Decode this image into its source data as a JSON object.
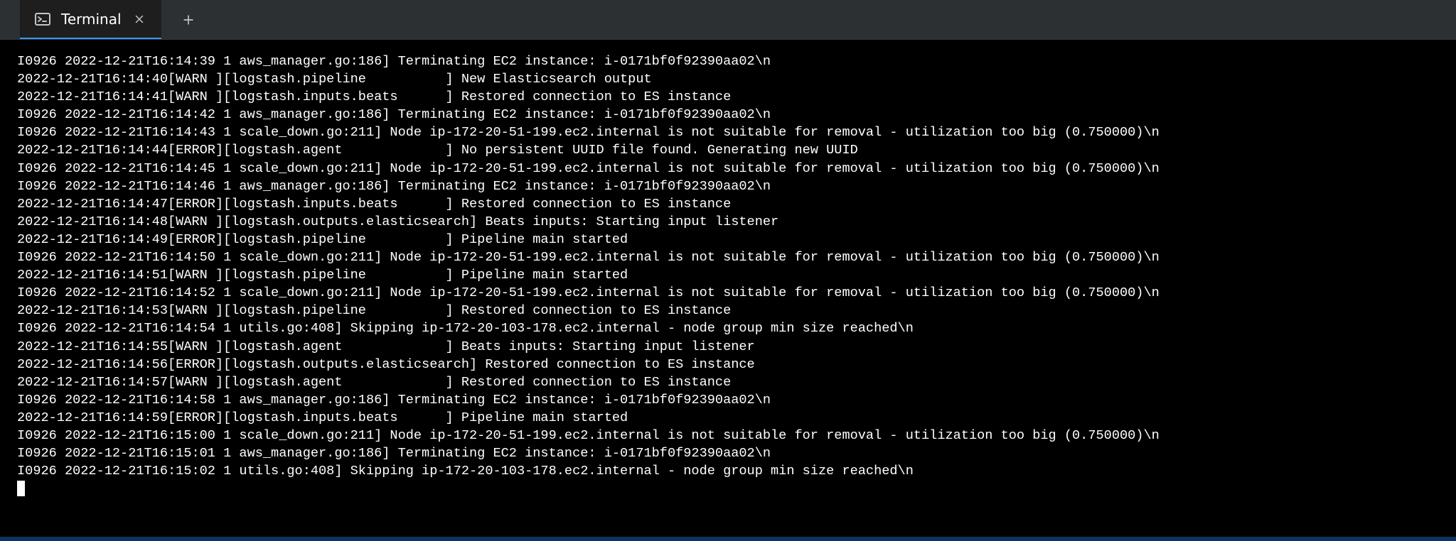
{
  "tab": {
    "label": "Terminal"
  },
  "terminal": {
    "lines": [
      "I0926 2022-12-21T16:14:39 1 aws_manager.go:186] Terminating EC2 instance: i-0171bf0f92390aa02\\n",
      "2022-12-21T16:14:40[WARN ][logstash.pipeline          ] New Elasticsearch output",
      "2022-12-21T16:14:41[WARN ][logstash.inputs.beats      ] Restored connection to ES instance",
      "I0926 2022-12-21T16:14:42 1 aws_manager.go:186] Terminating EC2 instance: i-0171bf0f92390aa02\\n",
      "I0926 2022-12-21T16:14:43 1 scale_down.go:211] Node ip-172-20-51-199.ec2.internal is not suitable for removal - utilization too big (0.750000)\\n",
      "2022-12-21T16:14:44[ERROR][logstash.agent             ] No persistent UUID file found. Generating new UUID",
      "I0926 2022-12-21T16:14:45 1 scale_down.go:211] Node ip-172-20-51-199.ec2.internal is not suitable for removal - utilization too big (0.750000)\\n",
      "I0926 2022-12-21T16:14:46 1 aws_manager.go:186] Terminating EC2 instance: i-0171bf0f92390aa02\\n",
      "2022-12-21T16:14:47[ERROR][logstash.inputs.beats      ] Restored connection to ES instance",
      "2022-12-21T16:14:48[WARN ][logstash.outputs.elasticsearch] Beats inputs: Starting input listener",
      "2022-12-21T16:14:49[ERROR][logstash.pipeline          ] Pipeline main started",
      "I0926 2022-12-21T16:14:50 1 scale_down.go:211] Node ip-172-20-51-199.ec2.internal is not suitable for removal - utilization too big (0.750000)\\n",
      "2022-12-21T16:14:51[WARN ][logstash.pipeline          ] Pipeline main started",
      "I0926 2022-12-21T16:14:52 1 scale_down.go:211] Node ip-172-20-51-199.ec2.internal is not suitable for removal - utilization too big (0.750000)\\n",
      "2022-12-21T16:14:53[WARN ][logstash.pipeline          ] Restored connection to ES instance",
      "I0926 2022-12-21T16:14:54 1 utils.go:408] Skipping ip-172-20-103-178.ec2.internal - node group min size reached\\n",
      "2022-12-21T16:14:55[WARN ][logstash.agent             ] Beats inputs: Starting input listener",
      "2022-12-21T16:14:56[ERROR][logstash.outputs.elasticsearch] Restored connection to ES instance",
      "2022-12-21T16:14:57[WARN ][logstash.agent             ] Restored connection to ES instance",
      "I0926 2022-12-21T16:14:58 1 aws_manager.go:186] Terminating EC2 instance: i-0171bf0f92390aa02\\n",
      "2022-12-21T16:14:59[ERROR][logstash.inputs.beats      ] Pipeline main started",
      "I0926 2022-12-21T16:15:00 1 scale_down.go:211] Node ip-172-20-51-199.ec2.internal is not suitable for removal - utilization too big (0.750000)\\n",
      "I0926 2022-12-21T16:15:01 1 aws_manager.go:186] Terminating EC2 instance: i-0171bf0f92390aa02\\n",
      "I0926 2022-12-21T16:15:02 1 utils.go:408] Skipping ip-172-20-103-178.ec2.internal - node group min size reached\\n"
    ]
  }
}
